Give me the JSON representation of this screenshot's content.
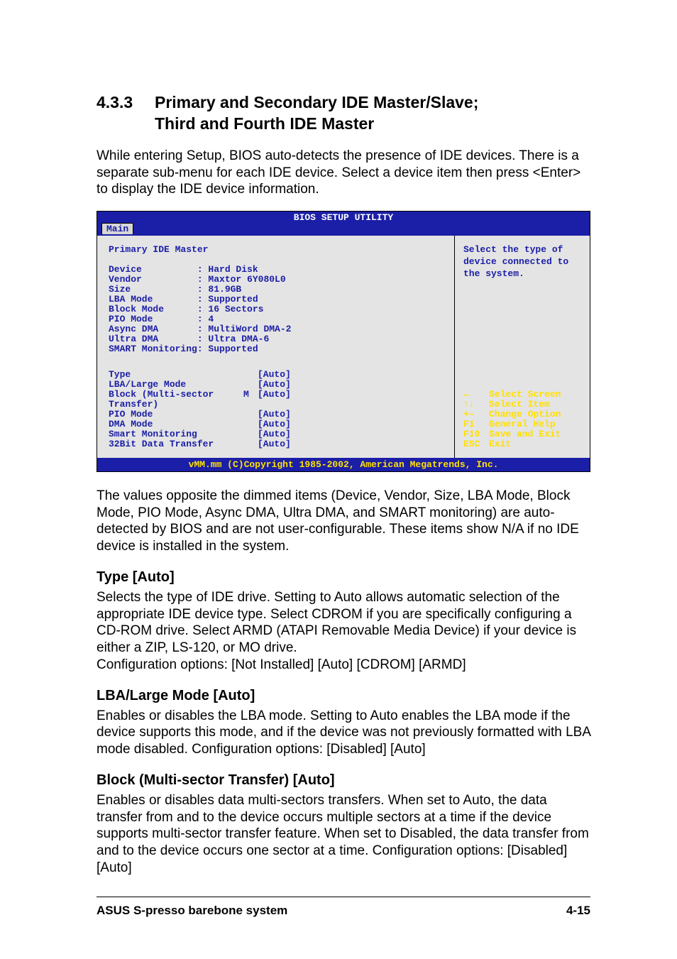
{
  "section": {
    "number": "4.3.3",
    "title_line1": "Primary and Secondary IDE Master/Slave;",
    "title_line2": "Third and Fourth IDE Master"
  },
  "intro": "While entering Setup, BIOS auto-detects the presence of IDE devices. There is a separate sub-menu for each IDE device. Select a device item then press <Enter> to display the IDE device information.",
  "bios": {
    "titlebar": "BIOS SETUP UTILITY",
    "tab": "Main",
    "left_title": "Primary IDE Master",
    "info": [
      {
        "label": "Device          ",
        "value": ": Hard Disk"
      },
      {
        "label": "Vendor          ",
        "value": ": Maxtor 6Y080L0"
      },
      {
        "label": "Size            ",
        "value": ": 81.9GB"
      },
      {
        "label": "LBA Mode        ",
        "value": ": Supported"
      },
      {
        "label": "Block Mode      ",
        "value": ": 16 Sectors"
      },
      {
        "label": "PIO Mode        ",
        "value": ": 4"
      },
      {
        "label": "Async DMA       ",
        "value": ": MultiWord DMA-2"
      },
      {
        "label": "Ultra DMA       ",
        "value": ": Ultra DMA-6"
      },
      {
        "label": "SMART Monitoring",
        "value": ": Supported"
      }
    ],
    "settings": [
      {
        "label": "Type",
        "mid": "",
        "value": "[Auto]"
      },
      {
        "label": "LBA/Large Mode",
        "mid": "",
        "value": "[Auto]"
      },
      {
        "label": "Block (Multi-sector Transfer)",
        "mid": "M",
        "value": "[Auto]"
      },
      {
        "label": "PIO Mode",
        "mid": "",
        "value": "[Auto]"
      },
      {
        "label": "DMA Mode",
        "mid": "",
        "value": "[Auto]"
      },
      {
        "label": "Smart Monitoring",
        "mid": "",
        "value": "[Auto]"
      },
      {
        "label": "32Bit Data Transfer",
        "mid": "",
        "value": "[Auto]"
      }
    ],
    "help": "Select the type of device connected to the system.",
    "keys": [
      {
        "k": "↔",
        "d": "Select Screen"
      },
      {
        "k": "↑↓",
        "d": "Select Item"
      },
      {
        "k": "+-",
        "d": "Change Option"
      },
      {
        "k": "F1",
        "d": "General Help"
      },
      {
        "k": "F10",
        "d": "Save and Exit"
      },
      {
        "k": "ESC",
        "d": "Exit"
      }
    ],
    "footer": "vMM.mm (C)Copyright 1985-2002, American Megatrends, Inc."
  },
  "after_bios": "The values opposite the dimmed items (Device, Vendor, Size, LBA Mode, Block Mode, PIO Mode, Async DMA, Ultra DMA, and SMART monitoring) are auto-detected by BIOS and are not user-configurable. These items show  N/A if no IDE device is installed in the system.",
  "options": {
    "type": {
      "heading": "Type [Auto]",
      "body": "Selects the type of IDE drive. Setting to Auto allows automatic selection of the appropriate IDE device type. Select CDROM if you are specifically configuring a CD-ROM drive. Select ARMD (ATAPI Removable Media Device) if your device is either a ZIP, LS-120, or MO drive.",
      "config": "Configuration options: [Not Installed] [Auto] [CDROM] [ARMD]"
    },
    "lba": {
      "heading": "LBA/Large Mode [Auto]",
      "body": "Enables or disables the LBA mode. Setting to Auto enables the LBA mode if the device supports this mode, and if the device was not previously formatted with LBA mode disabled. Configuration options: [Disabled] [Auto]"
    },
    "block": {
      "heading": "Block (Multi-sector Transfer) [Auto]",
      "body": "Enables or disables data multi-sectors transfers. When set to Auto, the data transfer from and to the device occurs multiple sectors at a time if the device supports multi-sector transfer feature. When set to Disabled, the data transfer from and to the device occurs one sector at a time. Configuration options: [Disabled] [Auto]"
    }
  },
  "footer": {
    "product": "ASUS S-presso barebone system",
    "page": "4-15"
  }
}
